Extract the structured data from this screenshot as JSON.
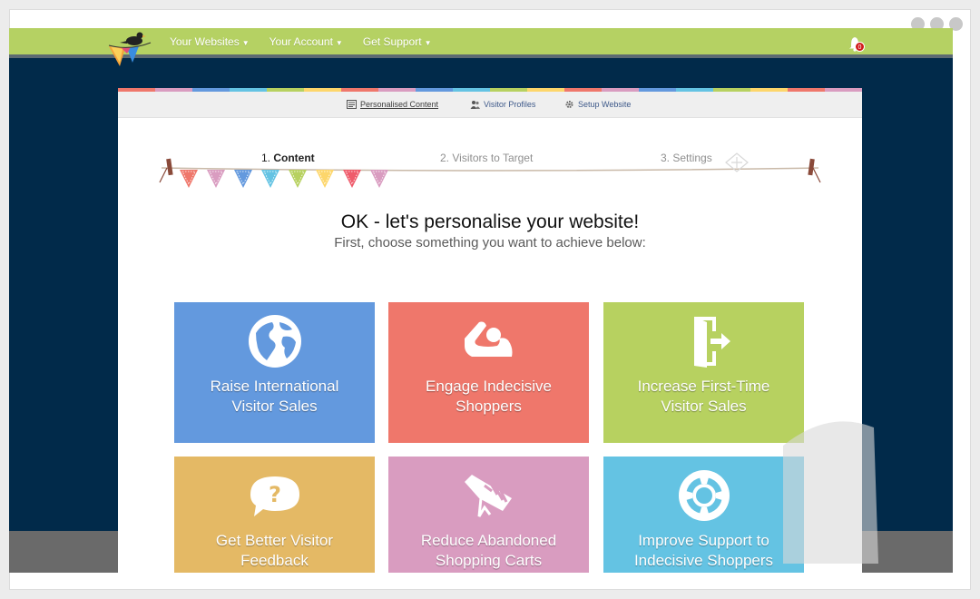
{
  "window": {
    "controls": [
      "dot",
      "dot",
      "dot"
    ]
  },
  "topbar": {
    "logo_icon": "bird-logo-icon",
    "nav": [
      {
        "label": "Your Websites"
      },
      {
        "label": "Your Account"
      },
      {
        "label": "Get Support"
      }
    ],
    "notifications": {
      "icon": "bell-icon",
      "count": "0"
    },
    "colors": {
      "bar": "#b5d163",
      "background": "#012a4a"
    }
  },
  "subnav": {
    "items": [
      {
        "label": "Personalised Content",
        "icon": "content-icon",
        "active": true
      },
      {
        "label": "Visitor Profiles",
        "icon": "users-icon",
        "active": false
      },
      {
        "label": "Setup Website",
        "icon": "gear-icon",
        "active": false
      }
    ]
  },
  "steps": [
    {
      "number": "1.",
      "label": "Content",
      "active": true
    },
    {
      "number": "2.",
      "label": "Visitors to Target",
      "active": false
    },
    {
      "number": "3.",
      "label": "Settings",
      "active": false
    }
  ],
  "intro": {
    "heading": "OK - let's personalise your website!",
    "subheading": "First, choose something you want to achieve below:"
  },
  "goals": [
    {
      "line1": "Raise International",
      "line2": "Visitor Sales",
      "icon": "globe-icon",
      "color": "#6399de"
    },
    {
      "line1": "Engage Indecisive",
      "line2": "Shoppers",
      "icon": "relaxing-person-icon",
      "color": "#ef776b"
    },
    {
      "line1": "Increase First-Time",
      "line2": "Visitor Sales",
      "icon": "door-exit-icon",
      "color": "#b7d160"
    },
    {
      "line1": "Get Better Visitor",
      "line2": "Feedback",
      "icon": "question-bubble-icon",
      "color": "#e4b965"
    },
    {
      "line1": "Reduce Abandoned",
      "line2": "Shopping Carts",
      "icon": "shopping-cart-icon",
      "color": "#d99cc0"
    },
    {
      "line1": "Improve Support to",
      "line2": "Indecisive Shoppers",
      "icon": "lifebuoy-icon",
      "color": "#64c3e3"
    }
  ]
}
